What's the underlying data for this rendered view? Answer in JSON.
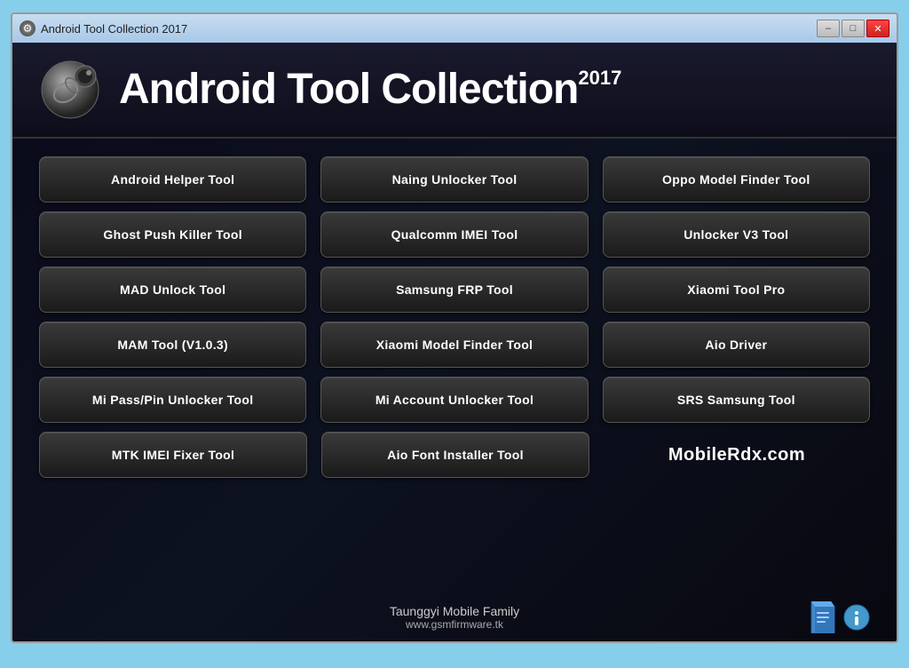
{
  "window": {
    "title": "Android Tool Collection 2017",
    "title_icon": "⚙",
    "controls": {
      "minimize": "–",
      "maximize": "□",
      "close": "✕"
    }
  },
  "header": {
    "title": "Android Tool Collection",
    "year": "2017"
  },
  "buttons": {
    "row1": [
      {
        "label": "Android Helper Tool",
        "name": "android-helper-tool-button"
      },
      {
        "label": "Naing Unlocker Tool",
        "name": "naing-unlocker-tool-button"
      },
      {
        "label": "Oppo Model Finder Tool",
        "name": "oppo-model-finder-tool-button"
      }
    ],
    "row2": [
      {
        "label": "Ghost Push Killer Tool",
        "name": "ghost-push-killer-tool-button"
      },
      {
        "label": "Qualcomm IMEI Tool",
        "name": "qualcomm-imei-tool-button"
      },
      {
        "label": "Unlocker V3 Tool",
        "name": "unlocker-v3-tool-button"
      }
    ],
    "row3": [
      {
        "label": "MAD Unlock Tool",
        "name": "mad-unlock-tool-button"
      },
      {
        "label": "Samsung FRP Tool",
        "name": "samsung-frp-tool-button"
      },
      {
        "label": "Xiaomi Tool Pro",
        "name": "xiaomi-tool-pro-button"
      }
    ],
    "row4": [
      {
        "label": "MAM Tool (V1.0.3)",
        "name": "mam-tool-button"
      },
      {
        "label": "Xiaomi Model Finder Tool",
        "name": "xiaomi-model-finder-tool-button"
      },
      {
        "label": "Aio Driver",
        "name": "aio-driver-button"
      }
    ],
    "row5": [
      {
        "label": "Mi Pass/Pin Unlocker Tool",
        "name": "mi-pass-pin-unlocker-tool-button"
      },
      {
        "label": "Mi Account Unlocker Tool",
        "name": "mi-account-unlocker-tool-button"
      },
      {
        "label": "SRS Samsung Tool",
        "name": "srs-samsung-tool-button"
      }
    ],
    "row6_left": [
      {
        "label": "MTK IMEI Fixer Tool",
        "name": "mtk-imei-fixer-tool-button"
      },
      {
        "label": "Aio Font Installer Tool",
        "name": "aio-font-installer-tool-button"
      }
    ],
    "row6_branding": "MobileRdx.com"
  },
  "footer": {
    "organization": "Taunggyi Mobile Family",
    "url": "www.gsmfirmware.tk"
  }
}
